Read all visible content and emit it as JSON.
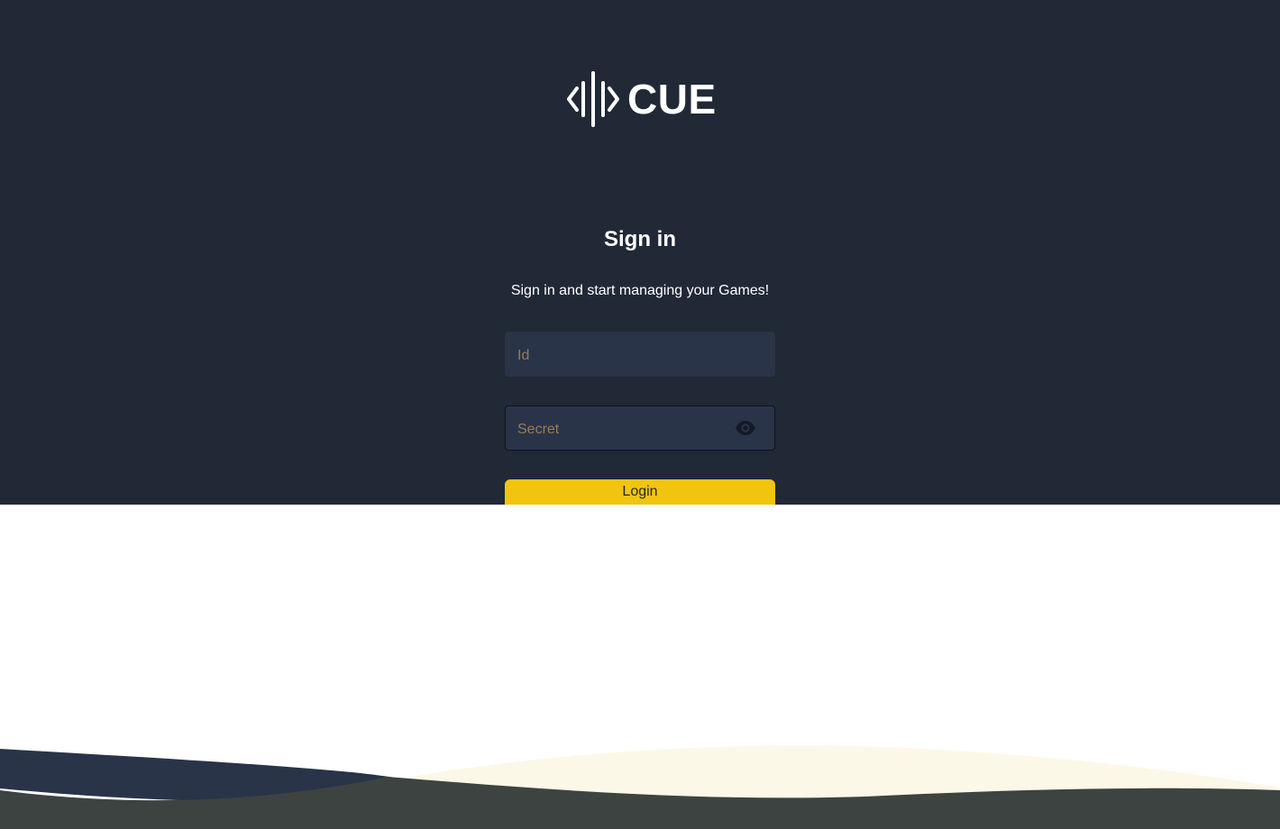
{
  "brand": {
    "name": "CUE",
    "colors": {
      "panel": "#212836",
      "field": "#293449",
      "accent": "#f1c40f",
      "placeholder": "#9a7b55",
      "wave_cream": "#fcf8e8",
      "wave_navy": "#293449",
      "wave_dark": "#3d4341"
    }
  },
  "signin": {
    "title": "Sign in",
    "subtitle": "Sign in and start managing your Games!",
    "id_field": {
      "placeholder": "Id",
      "value": ""
    },
    "secret_field": {
      "placeholder": "Secret",
      "value": "",
      "toggle_icon": "eye-icon"
    },
    "login_label": "Login"
  }
}
